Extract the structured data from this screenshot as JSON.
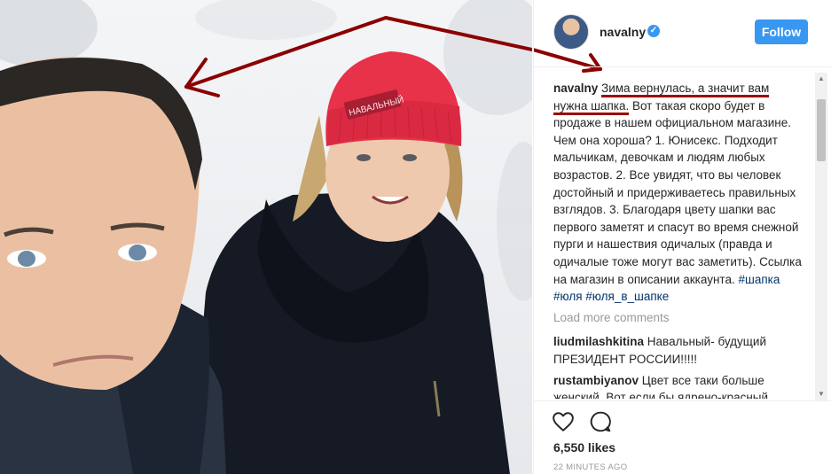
{
  "post": {
    "hat_text": "НАВАЛЬНЫЙ"
  },
  "header": {
    "username": "navalny",
    "verified_icon": "verified-badge-icon",
    "follow_label": "Follow"
  },
  "caption": {
    "author": "navalny",
    "underlined_text": "Зима вернулась, а значит вам нужна шапка.",
    "text": " Вот такая скоро будет в продаже в нашем официальном магазине. Чем она хороша? 1. Юнисекс. Подходит мальчикам, девочкам и людям любых возрастов. 2. Все увидят, что вы человек достойный и придерживаетесь правильных взглядов. 3. Благодаря цвету шапки вас первого заметят и спасут во время снежной пурги и нашествия одичалых (правда и одичалые тоже могут вас заметить). Ссылка на магазин в описании аккаунта.",
    "tags": [
      "#шапка",
      "#юля",
      "#юля_в_шапке"
    ]
  },
  "load_more": "Load more comments",
  "comments": [
    {
      "author": "liudmilashkitina",
      "text": "Навальный- будущий ПРЕЗИДЕНТ РОССИИ!!!!!"
    },
    {
      "author": "rustambiyanov",
      "text": "Цвет все таки больше женский. Вот если бы ядрено-красный"
    }
  ],
  "actions": {
    "like_icon": "heart-icon",
    "comment_icon": "comment-icon",
    "likes": "6,550 likes",
    "timestamp": "22 MINUTES AGO"
  },
  "colors": {
    "accent": "#3897f0",
    "annotation": "#8b0000",
    "hat": "#e8324a"
  }
}
